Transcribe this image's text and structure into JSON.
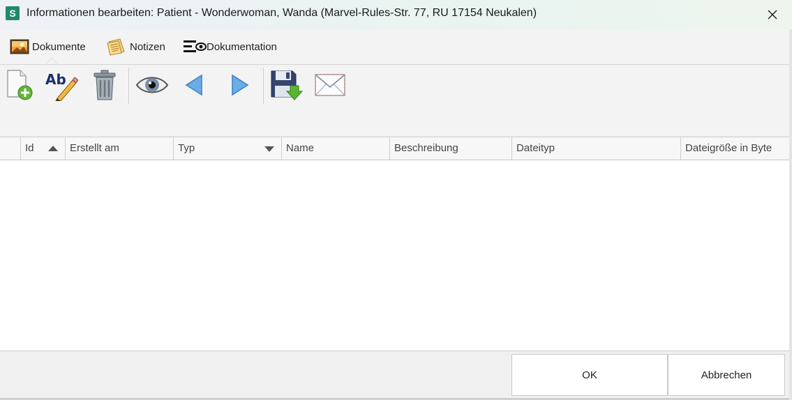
{
  "window": {
    "app_icon_letter": "S",
    "title": "Informationen bearbeiten: Patient - Wonderwoman, Wanda (Marvel-Rules-Str. 77, RU 17154 Neukalen)",
    "accent": "#1f8a6a"
  },
  "tabs": [
    {
      "label": "Dokumente",
      "icon": "image-icon",
      "selected": true
    },
    {
      "label": "Notizen",
      "icon": "notes-icon",
      "selected": false
    },
    {
      "label": "Dokumentation",
      "icon": "documentation-icon",
      "selected": false
    }
  ],
  "toolbar": [
    {
      "icon": "add-document-icon"
    },
    {
      "icon": "rename-icon"
    },
    {
      "icon": "trash-icon"
    },
    {
      "icon": "eye-icon"
    },
    {
      "icon": "previous-arrow-icon"
    },
    {
      "icon": "next-arrow-icon"
    },
    {
      "icon": "save-icon"
    },
    {
      "icon": "mail-icon"
    }
  ],
  "grid": {
    "columns": [
      {
        "label": ""
      },
      {
        "label": "Id",
        "sort": "ascending"
      },
      {
        "label": "Erstellt am"
      },
      {
        "label": "Typ",
        "filter": true
      },
      {
        "label": "Name"
      },
      {
        "label": "Beschreibung"
      },
      {
        "label": "Dateityp"
      },
      {
        "label": "Dateigröße in Byte"
      }
    ],
    "rows": []
  },
  "buttons": {
    "ok": "OK",
    "cancel": "Abbrechen"
  }
}
